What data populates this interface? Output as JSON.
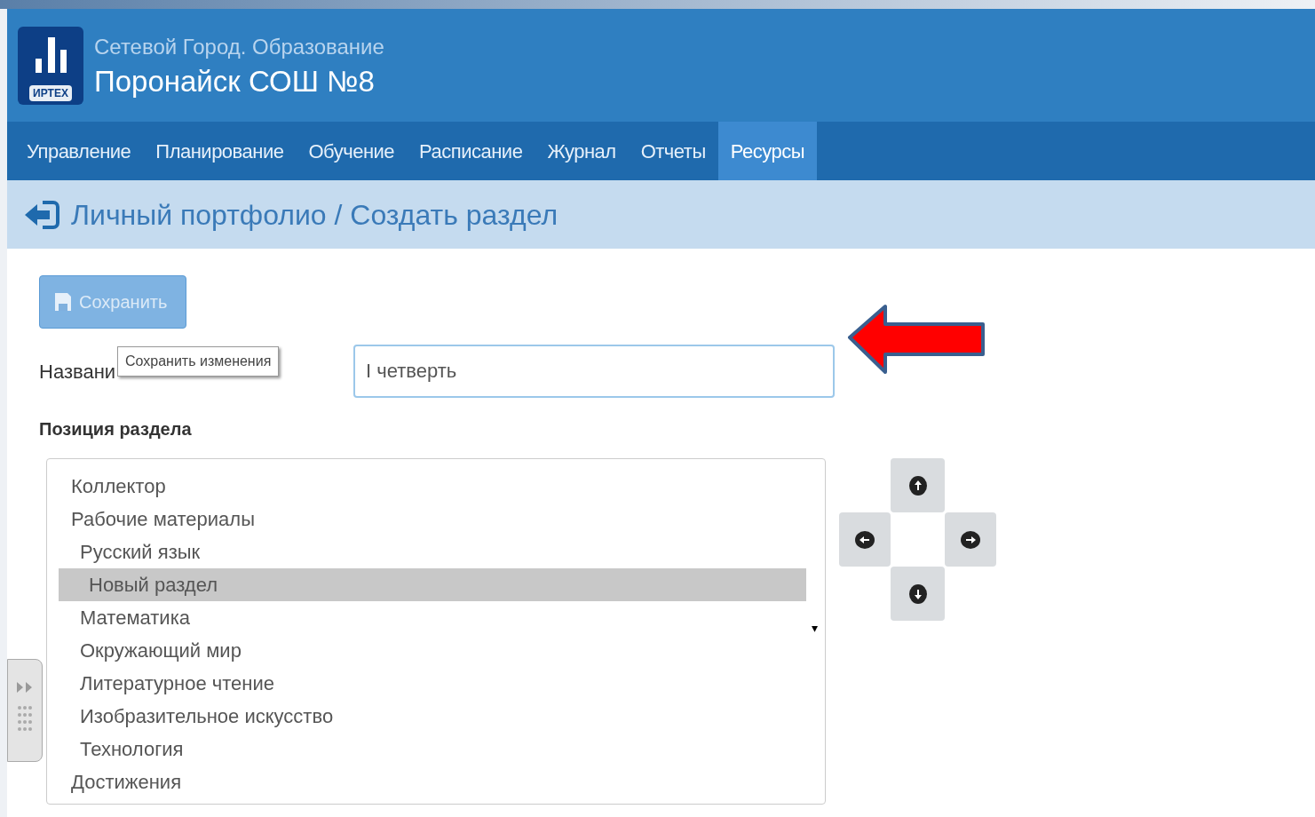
{
  "header": {
    "product": "Сетевой Город. Образование",
    "school": "Поронайск СОШ №8",
    "logo_text": "ИРТЕХ"
  },
  "nav": [
    {
      "label": "Управление",
      "selected": false
    },
    {
      "label": "Планирование",
      "selected": false
    },
    {
      "label": "Обучение",
      "selected": false
    },
    {
      "label": "Расписание",
      "selected": false
    },
    {
      "label": "Журнал",
      "selected": false
    },
    {
      "label": "Отчеты",
      "selected": false
    },
    {
      "label": "Ресурсы",
      "selected": true
    }
  ],
  "breadcrumb": "Личный портфолио / Создать раздел",
  "save_button": {
    "label": "Сохранить",
    "disabled": true
  },
  "tooltip": "Сохранить изменения",
  "name_field": {
    "label": "Названи",
    "value": "I четверть"
  },
  "position_label": "Позиция раздела",
  "tree": [
    {
      "label": "Коллектор",
      "selected": false
    },
    {
      "label": "Рабочие материалы",
      "selected": false,
      "children": [
        {
          "label": "Русский язык",
          "selected": false,
          "children": [
            {
              "label": "Новый раздел",
              "selected": true
            }
          ]
        },
        {
          "label": "Математика",
          "selected": false
        },
        {
          "label": "Окружающий мир",
          "selected": false
        },
        {
          "label": "Литературное чтение",
          "selected": false
        },
        {
          "label": "Изобразительное искусство",
          "selected": false
        },
        {
          "label": "Технология",
          "selected": false
        }
      ]
    },
    {
      "label": "Достижения",
      "selected": false
    }
  ],
  "list_marker": "▾"
}
